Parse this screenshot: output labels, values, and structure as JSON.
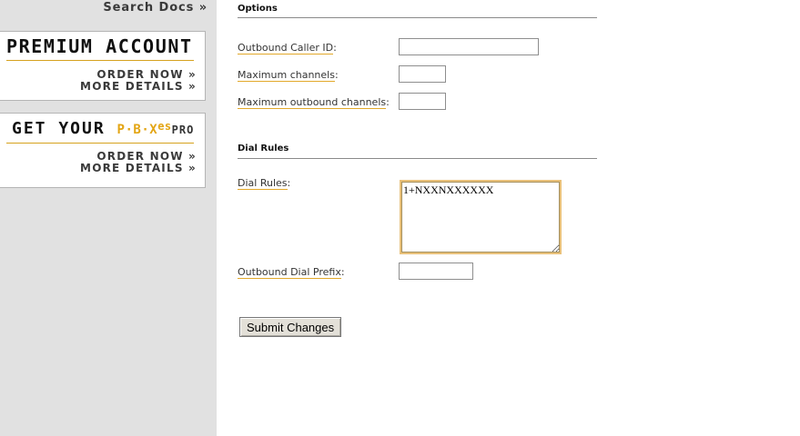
{
  "sidebar": {
    "search_docs": "Search Docs »",
    "premium": {
      "title": "PREMIUM ACCOUNT",
      "order_now": "ORDER NOW »",
      "more_details": "MORE DETAILS »"
    },
    "pbx": {
      "title_prefix": "GET YOUR",
      "brand": "P·B·X",
      "brand_sup": "es",
      "brand_suffix": "PRO",
      "order_now": "ORDER NOW »",
      "more_details": "MORE DETAILS »"
    }
  },
  "options": {
    "section_title": "Options",
    "outbound_caller_id": {
      "label": "Outbound Caller ID",
      "value": ""
    },
    "max_channels": {
      "label": "Maximum channels",
      "value": ""
    },
    "max_outbound_channels": {
      "label": "Maximum outbound channels",
      "value": ""
    }
  },
  "dial_rules": {
    "section_title": "Dial Rules",
    "rules": {
      "label": "Dial Rules",
      "value": "1+NXXNXXXXXX"
    },
    "outbound_prefix": {
      "label": "Outbound Dial Prefix",
      "value": ""
    }
  },
  "form": {
    "submit_label": "Submit Changes"
  },
  "colors": {
    "sidebar_bg": "#e1e1e1",
    "accent": "#e3a514",
    "label_underline": "#e2a82a"
  }
}
